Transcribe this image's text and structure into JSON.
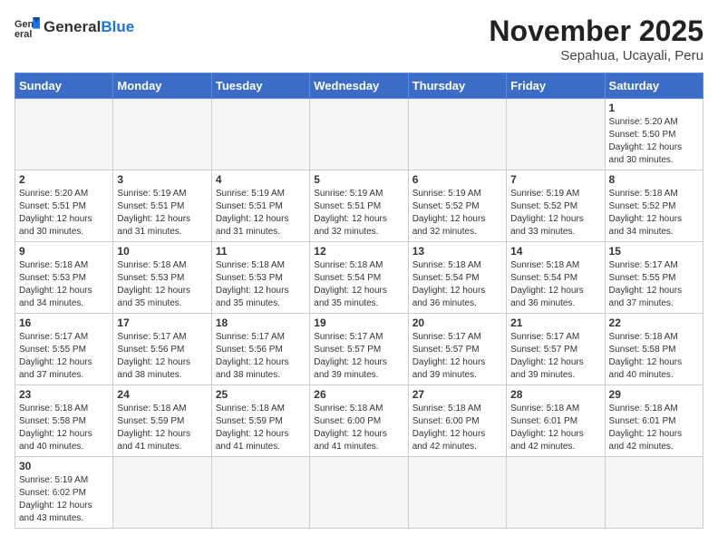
{
  "header": {
    "logo_general": "General",
    "logo_blue": "Blue",
    "month_title": "November 2025",
    "location": "Sepahua, Ucayali, Peru"
  },
  "weekdays": [
    "Sunday",
    "Monday",
    "Tuesday",
    "Wednesday",
    "Thursday",
    "Friday",
    "Saturday"
  ],
  "weeks": [
    [
      {
        "day": "",
        "info": ""
      },
      {
        "day": "",
        "info": ""
      },
      {
        "day": "",
        "info": ""
      },
      {
        "day": "",
        "info": ""
      },
      {
        "day": "",
        "info": ""
      },
      {
        "day": "",
        "info": ""
      },
      {
        "day": "1",
        "info": "Sunrise: 5:20 AM\nSunset: 5:50 PM\nDaylight: 12 hours and 30 minutes."
      }
    ],
    [
      {
        "day": "2",
        "info": "Sunrise: 5:20 AM\nSunset: 5:51 PM\nDaylight: 12 hours and 30 minutes."
      },
      {
        "day": "3",
        "info": "Sunrise: 5:19 AM\nSunset: 5:51 PM\nDaylight: 12 hours and 31 minutes."
      },
      {
        "day": "4",
        "info": "Sunrise: 5:19 AM\nSunset: 5:51 PM\nDaylight: 12 hours and 31 minutes."
      },
      {
        "day": "5",
        "info": "Sunrise: 5:19 AM\nSunset: 5:51 PM\nDaylight: 12 hours and 32 minutes."
      },
      {
        "day": "6",
        "info": "Sunrise: 5:19 AM\nSunset: 5:52 PM\nDaylight: 12 hours and 32 minutes."
      },
      {
        "day": "7",
        "info": "Sunrise: 5:19 AM\nSunset: 5:52 PM\nDaylight: 12 hours and 33 minutes."
      },
      {
        "day": "8",
        "info": "Sunrise: 5:18 AM\nSunset: 5:52 PM\nDaylight: 12 hours and 34 minutes."
      }
    ],
    [
      {
        "day": "9",
        "info": "Sunrise: 5:18 AM\nSunset: 5:53 PM\nDaylight: 12 hours and 34 minutes."
      },
      {
        "day": "10",
        "info": "Sunrise: 5:18 AM\nSunset: 5:53 PM\nDaylight: 12 hours and 35 minutes."
      },
      {
        "day": "11",
        "info": "Sunrise: 5:18 AM\nSunset: 5:53 PM\nDaylight: 12 hours and 35 minutes."
      },
      {
        "day": "12",
        "info": "Sunrise: 5:18 AM\nSunset: 5:54 PM\nDaylight: 12 hours and 35 minutes."
      },
      {
        "day": "13",
        "info": "Sunrise: 5:18 AM\nSunset: 5:54 PM\nDaylight: 12 hours and 36 minutes."
      },
      {
        "day": "14",
        "info": "Sunrise: 5:18 AM\nSunset: 5:54 PM\nDaylight: 12 hours and 36 minutes."
      },
      {
        "day": "15",
        "info": "Sunrise: 5:17 AM\nSunset: 5:55 PM\nDaylight: 12 hours and 37 minutes."
      }
    ],
    [
      {
        "day": "16",
        "info": "Sunrise: 5:17 AM\nSunset: 5:55 PM\nDaylight: 12 hours and 37 minutes."
      },
      {
        "day": "17",
        "info": "Sunrise: 5:17 AM\nSunset: 5:56 PM\nDaylight: 12 hours and 38 minutes."
      },
      {
        "day": "18",
        "info": "Sunrise: 5:17 AM\nSunset: 5:56 PM\nDaylight: 12 hours and 38 minutes."
      },
      {
        "day": "19",
        "info": "Sunrise: 5:17 AM\nSunset: 5:57 PM\nDaylight: 12 hours and 39 minutes."
      },
      {
        "day": "20",
        "info": "Sunrise: 5:17 AM\nSunset: 5:57 PM\nDaylight: 12 hours and 39 minutes."
      },
      {
        "day": "21",
        "info": "Sunrise: 5:17 AM\nSunset: 5:57 PM\nDaylight: 12 hours and 39 minutes."
      },
      {
        "day": "22",
        "info": "Sunrise: 5:18 AM\nSunset: 5:58 PM\nDaylight: 12 hours and 40 minutes."
      }
    ],
    [
      {
        "day": "23",
        "info": "Sunrise: 5:18 AM\nSunset: 5:58 PM\nDaylight: 12 hours and 40 minutes."
      },
      {
        "day": "24",
        "info": "Sunrise: 5:18 AM\nSunset: 5:59 PM\nDaylight: 12 hours and 41 minutes."
      },
      {
        "day": "25",
        "info": "Sunrise: 5:18 AM\nSunset: 5:59 PM\nDaylight: 12 hours and 41 minutes."
      },
      {
        "day": "26",
        "info": "Sunrise: 5:18 AM\nSunset: 6:00 PM\nDaylight: 12 hours and 41 minutes."
      },
      {
        "day": "27",
        "info": "Sunrise: 5:18 AM\nSunset: 6:00 PM\nDaylight: 12 hours and 42 minutes."
      },
      {
        "day": "28",
        "info": "Sunrise: 5:18 AM\nSunset: 6:01 PM\nDaylight: 12 hours and 42 minutes."
      },
      {
        "day": "29",
        "info": "Sunrise: 5:18 AM\nSunset: 6:01 PM\nDaylight: 12 hours and 42 minutes."
      }
    ],
    [
      {
        "day": "30",
        "info": "Sunrise: 5:19 AM\nSunset: 6:02 PM\nDaylight: 12 hours and 43 minutes."
      },
      {
        "day": "",
        "info": ""
      },
      {
        "day": "",
        "info": ""
      },
      {
        "day": "",
        "info": ""
      },
      {
        "day": "",
        "info": ""
      },
      {
        "day": "",
        "info": ""
      },
      {
        "day": "",
        "info": ""
      }
    ]
  ]
}
